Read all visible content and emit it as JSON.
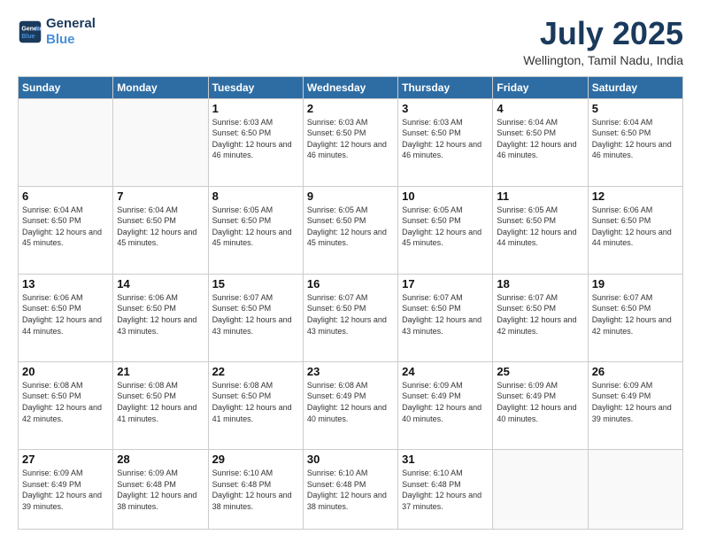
{
  "logo": {
    "line1": "General",
    "line2": "Blue"
  },
  "header": {
    "month": "July 2025",
    "location": "Wellington, Tamil Nadu, India"
  },
  "weekdays": [
    "Sunday",
    "Monday",
    "Tuesday",
    "Wednesday",
    "Thursday",
    "Friday",
    "Saturday"
  ],
  "weeks": [
    [
      {
        "day": "",
        "info": ""
      },
      {
        "day": "",
        "info": ""
      },
      {
        "day": "1",
        "info": "Sunrise: 6:03 AM\nSunset: 6:50 PM\nDaylight: 12 hours and 46 minutes."
      },
      {
        "day": "2",
        "info": "Sunrise: 6:03 AM\nSunset: 6:50 PM\nDaylight: 12 hours and 46 minutes."
      },
      {
        "day": "3",
        "info": "Sunrise: 6:03 AM\nSunset: 6:50 PM\nDaylight: 12 hours and 46 minutes."
      },
      {
        "day": "4",
        "info": "Sunrise: 6:04 AM\nSunset: 6:50 PM\nDaylight: 12 hours and 46 minutes."
      },
      {
        "day": "5",
        "info": "Sunrise: 6:04 AM\nSunset: 6:50 PM\nDaylight: 12 hours and 46 minutes."
      }
    ],
    [
      {
        "day": "6",
        "info": "Sunrise: 6:04 AM\nSunset: 6:50 PM\nDaylight: 12 hours and 45 minutes."
      },
      {
        "day": "7",
        "info": "Sunrise: 6:04 AM\nSunset: 6:50 PM\nDaylight: 12 hours and 45 minutes."
      },
      {
        "day": "8",
        "info": "Sunrise: 6:05 AM\nSunset: 6:50 PM\nDaylight: 12 hours and 45 minutes."
      },
      {
        "day": "9",
        "info": "Sunrise: 6:05 AM\nSunset: 6:50 PM\nDaylight: 12 hours and 45 minutes."
      },
      {
        "day": "10",
        "info": "Sunrise: 6:05 AM\nSunset: 6:50 PM\nDaylight: 12 hours and 45 minutes."
      },
      {
        "day": "11",
        "info": "Sunrise: 6:05 AM\nSunset: 6:50 PM\nDaylight: 12 hours and 44 minutes."
      },
      {
        "day": "12",
        "info": "Sunrise: 6:06 AM\nSunset: 6:50 PM\nDaylight: 12 hours and 44 minutes."
      }
    ],
    [
      {
        "day": "13",
        "info": "Sunrise: 6:06 AM\nSunset: 6:50 PM\nDaylight: 12 hours and 44 minutes."
      },
      {
        "day": "14",
        "info": "Sunrise: 6:06 AM\nSunset: 6:50 PM\nDaylight: 12 hours and 43 minutes."
      },
      {
        "day": "15",
        "info": "Sunrise: 6:07 AM\nSunset: 6:50 PM\nDaylight: 12 hours and 43 minutes."
      },
      {
        "day": "16",
        "info": "Sunrise: 6:07 AM\nSunset: 6:50 PM\nDaylight: 12 hours and 43 minutes."
      },
      {
        "day": "17",
        "info": "Sunrise: 6:07 AM\nSunset: 6:50 PM\nDaylight: 12 hours and 43 minutes."
      },
      {
        "day": "18",
        "info": "Sunrise: 6:07 AM\nSunset: 6:50 PM\nDaylight: 12 hours and 42 minutes."
      },
      {
        "day": "19",
        "info": "Sunrise: 6:07 AM\nSunset: 6:50 PM\nDaylight: 12 hours and 42 minutes."
      }
    ],
    [
      {
        "day": "20",
        "info": "Sunrise: 6:08 AM\nSunset: 6:50 PM\nDaylight: 12 hours and 42 minutes."
      },
      {
        "day": "21",
        "info": "Sunrise: 6:08 AM\nSunset: 6:50 PM\nDaylight: 12 hours and 41 minutes."
      },
      {
        "day": "22",
        "info": "Sunrise: 6:08 AM\nSunset: 6:50 PM\nDaylight: 12 hours and 41 minutes."
      },
      {
        "day": "23",
        "info": "Sunrise: 6:08 AM\nSunset: 6:49 PM\nDaylight: 12 hours and 40 minutes."
      },
      {
        "day": "24",
        "info": "Sunrise: 6:09 AM\nSunset: 6:49 PM\nDaylight: 12 hours and 40 minutes."
      },
      {
        "day": "25",
        "info": "Sunrise: 6:09 AM\nSunset: 6:49 PM\nDaylight: 12 hours and 40 minutes."
      },
      {
        "day": "26",
        "info": "Sunrise: 6:09 AM\nSunset: 6:49 PM\nDaylight: 12 hours and 39 minutes."
      }
    ],
    [
      {
        "day": "27",
        "info": "Sunrise: 6:09 AM\nSunset: 6:49 PM\nDaylight: 12 hours and 39 minutes."
      },
      {
        "day": "28",
        "info": "Sunrise: 6:09 AM\nSunset: 6:48 PM\nDaylight: 12 hours and 38 minutes."
      },
      {
        "day": "29",
        "info": "Sunrise: 6:10 AM\nSunset: 6:48 PM\nDaylight: 12 hours and 38 minutes."
      },
      {
        "day": "30",
        "info": "Sunrise: 6:10 AM\nSunset: 6:48 PM\nDaylight: 12 hours and 38 minutes."
      },
      {
        "day": "31",
        "info": "Sunrise: 6:10 AM\nSunset: 6:48 PM\nDaylight: 12 hours and 37 minutes."
      },
      {
        "day": "",
        "info": ""
      },
      {
        "day": "",
        "info": ""
      }
    ]
  ]
}
